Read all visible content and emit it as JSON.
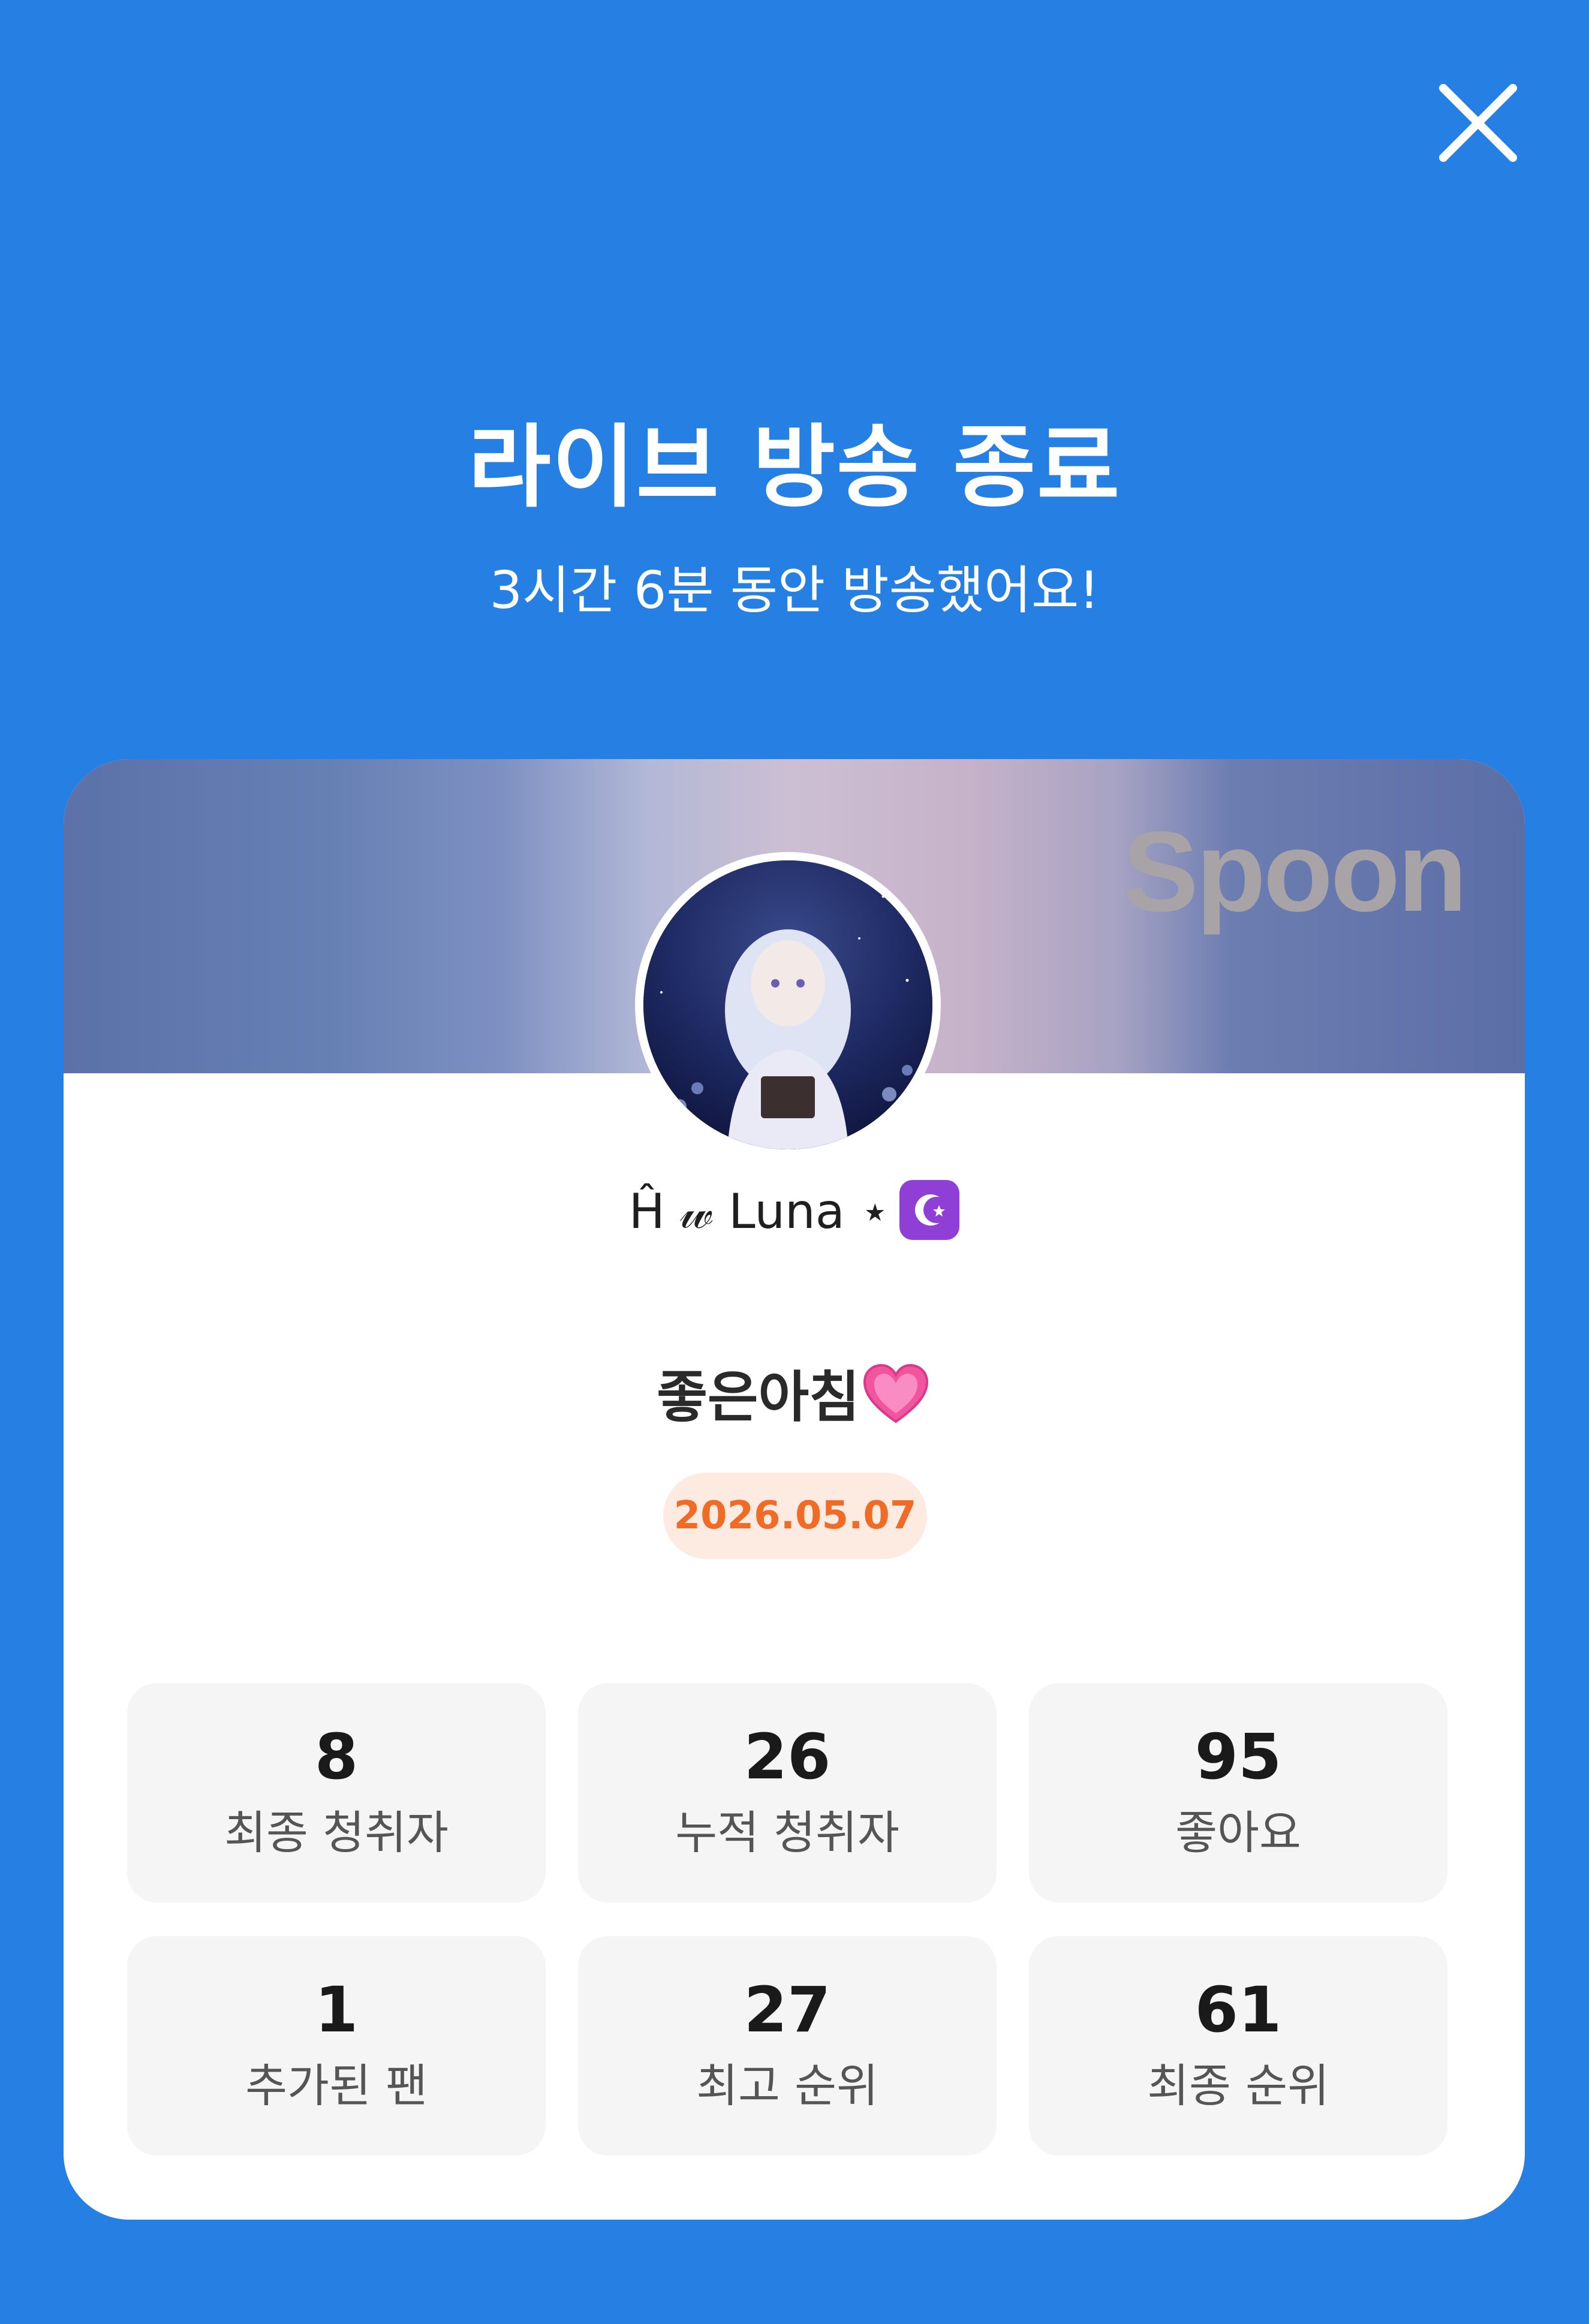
{
  "header": {
    "title": "라이브 방송 종료",
    "subtitle": "3시간 6분 동안 방송했어요!"
  },
  "card": {
    "brand": "Spoon",
    "username_prefix": "Ĥ  𝓌 Luna ⋆",
    "username_badge_icon": "moon-icon",
    "broadcast_title": "좋은아침",
    "broadcast_title_icon": "heart-icon",
    "date": "2026.05.07",
    "stats": [
      {
        "value": "8",
        "label": "최종 청취자"
      },
      {
        "value": "26",
        "label": "누적 청취자"
      },
      {
        "value": "95",
        "label": "좋아요"
      },
      {
        "value": "1",
        "label": "추가된 팬"
      },
      {
        "value": "27",
        "label": "최고 순위"
      },
      {
        "value": "61",
        "label": "최종 순위"
      }
    ]
  },
  "colors": {
    "background": "#2680e3",
    "date_text": "#f06b25",
    "date_bg": "#fdebe1",
    "stat_bg": "#f5f5f5"
  }
}
